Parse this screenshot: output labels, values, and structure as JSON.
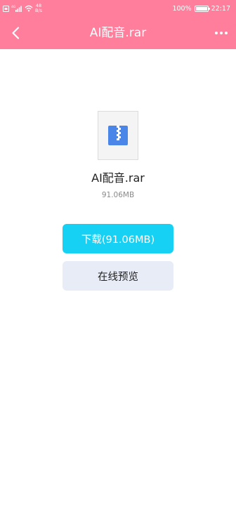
{
  "status_bar": {
    "net_speed_value": "48",
    "net_speed_unit": "B/s",
    "battery_text": "100%",
    "battery_level": 1.0,
    "time": "22:17"
  },
  "app_bar": {
    "title": "AI配音.rar",
    "back_icon": "chevron-left-icon",
    "more_icon": "more-horizontal-icon"
  },
  "file": {
    "icon": "zip-archive-icon",
    "name": "AI配音.rar",
    "size": "91.06MB"
  },
  "actions": {
    "download_label": "下载(91.06MB)",
    "preview_label": "在线预览"
  },
  "colors": {
    "header": "#ff7e9c",
    "download_button": "#16d1f4",
    "preview_button": "#e8ecf6",
    "file_icon": "#4a86e8"
  }
}
